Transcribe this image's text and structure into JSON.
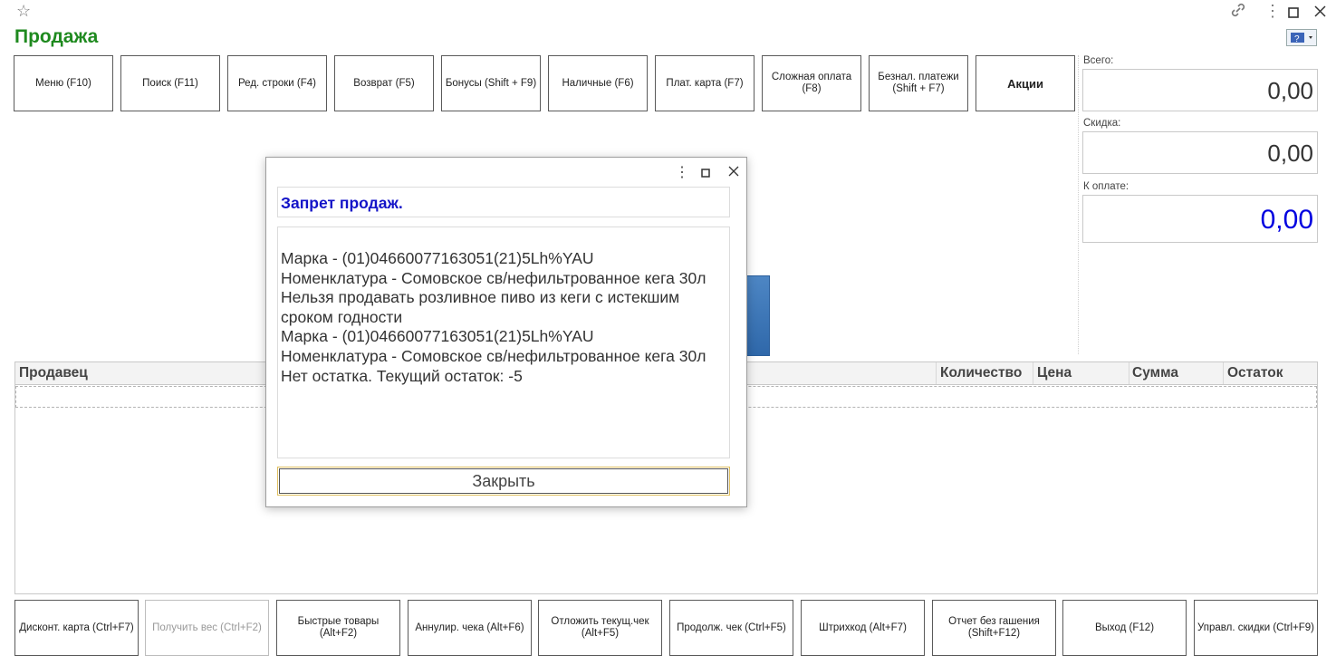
{
  "window": {
    "title": "Продажа",
    "star_icon": "star-icon",
    "link_icon": "link-icon",
    "more_icon": "more-icon",
    "maximize_icon": "maximize-icon",
    "close_icon": "close-icon",
    "help_icon": "help-icon"
  },
  "toolbar": {
    "buttons": [
      "Меню (F10)",
      "Поиск (F11)",
      "Ред. строки (F4)",
      "Возврат (F5)",
      "Бонусы (Shift + F9)",
      "Наличные (F6)",
      "Плат. карта (F7)",
      "Сложная оплата (F8)",
      "Безнал. платежи (Shift + F7)",
      "Акции"
    ]
  },
  "totals": {
    "total_label": "Всего:",
    "total_value": "0,00",
    "discount_label": "Скидка:",
    "discount_value": "0,00",
    "pay_label": "К оплате:",
    "pay_value": "0,00"
  },
  "table": {
    "columns": [
      "Продавец",
      "Количество",
      "Цена",
      "Сумма",
      "Остаток"
    ]
  },
  "modal": {
    "header": "Запрет продаж.",
    "lines": [
      "Марка - (01)04660077163051(21)5Lh%YAU",
      "Номенклатура - Сомовское св/нефильтрованное кега 30л",
      "Нельзя продавать розливное пиво из кеги с истекшим",
      "сроком годности",
      "Марка - (01)04660077163051(21)5Lh%YAU",
      "Номенклатура - Сомовское св/нефильтрованное кега 30л",
      "Нет остатка. Текущий остаток: -5"
    ],
    "close_label": "Закрыть"
  },
  "bottom_bar": {
    "buttons": [
      "Дисконт. карта (Ctrl+F7)",
      "Получить вес (Ctrl+F2)",
      "Быстрые товары (Alt+F2)",
      "Аннулир. чека (Alt+F6)",
      "Отложить текущ.чек (Alt+F5)",
      "Продолж. чек (Ctrl+F5)",
      "Штрихкод (Alt+F7)",
      "Отчет без гашения (Shift+F12)",
      "Выход (F12)",
      "Управл. скидки (Ctrl+F9)"
    ]
  },
  "colors": {
    "title": "#1f8a1f",
    "modal_header": "#1414c8",
    "pay_value": "#0000e0"
  }
}
